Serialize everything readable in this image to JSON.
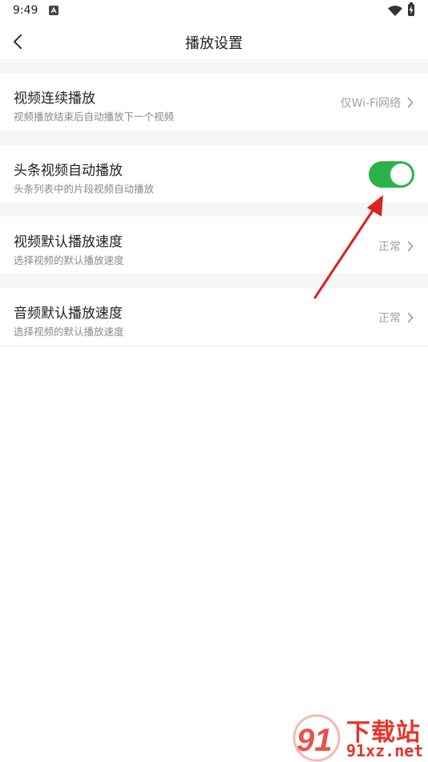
{
  "status_bar": {
    "time": "9:49"
  },
  "header": {
    "title": "播放设置"
  },
  "settings": [
    {
      "title": "视频连续播放",
      "subtitle": "视频播放结束后自动播放下一个视频",
      "value": "仅Wi-Fi网络"
    },
    {
      "title": "头条视频自动播放",
      "subtitle": "头条列表中的片段视频自动播放",
      "toggle_on": true
    },
    {
      "title": "视频默认播放速度",
      "subtitle": "选择视频的默认播放速度",
      "value": "正常"
    },
    {
      "title": "音频默认播放速度",
      "subtitle": "选择视频的默认播放速度",
      "value": "正常"
    }
  ],
  "watermark": {
    "text": "下载站",
    "url": "91xz.net",
    "logo_text": "91"
  },
  "colors": {
    "toggle_on": "#2bb34a",
    "annotation_arrow": "#d8231e",
    "watermark": "#e8332a"
  },
  "icons": [
    "back-arrow-icon",
    "wifi-icon",
    "battery-icon",
    "chevron-right-icon"
  ]
}
